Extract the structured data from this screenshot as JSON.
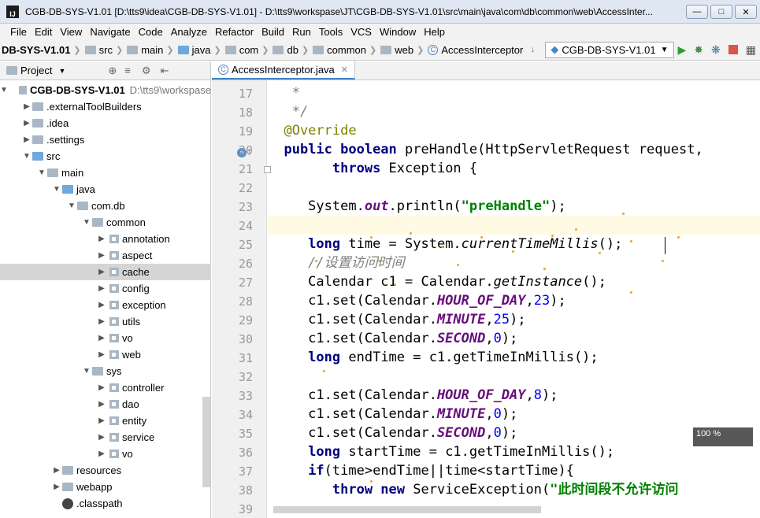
{
  "window": {
    "title": "CGB-DB-SYS-V1.01 [D:\\tts9\\idea\\CGB-DB-SYS-V1.01] - D:\\tts9\\workspase\\JT\\CGB-DB-SYS-V1.01\\src\\main\\java\\com\\db\\common\\web\\AccessInter..."
  },
  "menu": [
    "File",
    "Edit",
    "View",
    "Navigate",
    "Code",
    "Analyze",
    "Refactor",
    "Build",
    "Run",
    "Tools",
    "VCS",
    "Window",
    "Help"
  ],
  "breadcrumb": [
    "DB-SYS-V1.01",
    "src",
    "main",
    "java",
    "com",
    "db",
    "common",
    "web",
    "AccessInterceptor"
  ],
  "run_config": "CGB-DB-SYS-V1.01",
  "sidebar": {
    "title": "Project",
    "root_name": "CGB-DB-SYS-V1.01",
    "root_path": "D:\\tts9\\workspase",
    "items": [
      {
        "label": ".externalToolBuilders",
        "depth": 1,
        "arrow": "right"
      },
      {
        "label": ".idea",
        "depth": 1,
        "arrow": "right"
      },
      {
        "label": ".settings",
        "depth": 1,
        "arrow": "right"
      },
      {
        "label": "src",
        "depth": 1,
        "arrow": "down"
      },
      {
        "label": "main",
        "depth": 2,
        "arrow": "down"
      },
      {
        "label": "java",
        "depth": 3,
        "arrow": "down"
      },
      {
        "label": "com.db",
        "depth": 4,
        "arrow": "down"
      },
      {
        "label": "common",
        "depth": 5,
        "arrow": "down"
      },
      {
        "label": "annotation",
        "depth": 6,
        "arrow": "right"
      },
      {
        "label": "aspect",
        "depth": 6,
        "arrow": "right"
      },
      {
        "label": "cache",
        "depth": 6,
        "arrow": "right",
        "selected": true
      },
      {
        "label": "config",
        "depth": 6,
        "arrow": "right"
      },
      {
        "label": "exception",
        "depth": 6,
        "arrow": "right"
      },
      {
        "label": "utils",
        "depth": 6,
        "arrow": "right"
      },
      {
        "label": "vo",
        "depth": 6,
        "arrow": "right"
      },
      {
        "label": "web",
        "depth": 6,
        "arrow": "right"
      },
      {
        "label": "sys",
        "depth": 5,
        "arrow": "down"
      },
      {
        "label": "controller",
        "depth": 6,
        "arrow": "right"
      },
      {
        "label": "dao",
        "depth": 6,
        "arrow": "right"
      },
      {
        "label": "entity",
        "depth": 6,
        "arrow": "right"
      },
      {
        "label": "service",
        "depth": 6,
        "arrow": "right"
      },
      {
        "label": "vo",
        "depth": 6,
        "arrow": "right"
      },
      {
        "label": "resources",
        "depth": 3,
        "arrow": "right"
      },
      {
        "label": "webapp",
        "depth": 3,
        "arrow": "right"
      },
      {
        "label": ".classpath",
        "depth": 3,
        "arrow": ""
      }
    ]
  },
  "editor": {
    "tab_label": "AccessInterceptor.java",
    "line_numbers": [
      "17",
      "18",
      "19",
      "20",
      "21",
      "22",
      "23",
      "24",
      "25",
      "26",
      "27",
      "28",
      "29",
      "30",
      "31",
      "32",
      "33",
      "34",
      "35",
      "36",
      "37",
      "38",
      "39"
    ],
    "lines": [
      [
        {
          "t": "   *",
          "c": "cmt"
        }
      ],
      [
        {
          "t": "   */",
          "c": "cmt"
        }
      ],
      [
        {
          "t": "  @Override",
          "c": "ann"
        }
      ],
      [
        {
          "t": "  ",
          "c": ""
        },
        {
          "t": "public boolean ",
          "c": "kw"
        },
        {
          "t": "preHandle(HttpServletRequest request,",
          "c": ""
        }
      ],
      [
        {
          "t": "        ",
          "c": ""
        },
        {
          "t": "throws ",
          "c": "kw"
        },
        {
          "t": "Exception {",
          "c": ""
        }
      ],
      [],
      [
        {
          "t": "     System.",
          "c": ""
        },
        {
          "t": "out",
          "c": "fld"
        },
        {
          "t": ".println(",
          "c": ""
        },
        {
          "t": "\"preHandle\"",
          "c": "str"
        },
        {
          "t": ");",
          "c": ""
        }
      ],
      [],
      [
        {
          "t": "     ",
          "c": ""
        },
        {
          "t": "long ",
          "c": "kw"
        },
        {
          "t": "time = System.",
          "c": ""
        },
        {
          "t": "currentTimeMillis",
          "c": "stat"
        },
        {
          "t": "();",
          "c": ""
        }
      ],
      [
        {
          "t": "     //设置访问时间",
          "c": "cmt"
        }
      ],
      [
        {
          "t": "     Calendar c1 = Calendar.",
          "c": ""
        },
        {
          "t": "getInstance",
          "c": "stat"
        },
        {
          "t": "();",
          "c": ""
        }
      ],
      [
        {
          "t": "     c1.set(Calendar.",
          "c": ""
        },
        {
          "t": "HOUR_OF_DAY",
          "c": "fld"
        },
        {
          "t": ",",
          "c": ""
        },
        {
          "t": "23",
          "c": "num"
        },
        {
          "t": ");",
          "c": ""
        }
      ],
      [
        {
          "t": "     c1.set(Calendar.",
          "c": ""
        },
        {
          "t": "MINUTE",
          "c": "fld"
        },
        {
          "t": ",",
          "c": ""
        },
        {
          "t": "25",
          "c": "num"
        },
        {
          "t": ");",
          "c": ""
        }
      ],
      [
        {
          "t": "     c1.set(Calendar.",
          "c": ""
        },
        {
          "t": "SECOND",
          "c": "fld"
        },
        {
          "t": ",",
          "c": ""
        },
        {
          "t": "0",
          "c": "num"
        },
        {
          "t": ");",
          "c": ""
        }
      ],
      [
        {
          "t": "     ",
          "c": ""
        },
        {
          "t": "long ",
          "c": "kw"
        },
        {
          "t": "endTime = c1.getTimeInMillis();",
          "c": ""
        }
      ],
      [],
      [
        {
          "t": "     c1.set(Calendar.",
          "c": ""
        },
        {
          "t": "HOUR_OF_DAY",
          "c": "fld"
        },
        {
          "t": ",",
          "c": ""
        },
        {
          "t": "8",
          "c": "num"
        },
        {
          "t": ");",
          "c": ""
        }
      ],
      [
        {
          "t": "     c1.set(Calendar.",
          "c": ""
        },
        {
          "t": "MINUTE",
          "c": "fld"
        },
        {
          "t": ",",
          "c": ""
        },
        {
          "t": "0",
          "c": "num"
        },
        {
          "t": ");",
          "c": ""
        }
      ],
      [
        {
          "t": "     c1.set(Calendar.",
          "c": ""
        },
        {
          "t": "SECOND",
          "c": "fld"
        },
        {
          "t": ",",
          "c": ""
        },
        {
          "t": "0",
          "c": "num"
        },
        {
          "t": ");",
          "c": ""
        }
      ],
      [
        {
          "t": "     ",
          "c": ""
        },
        {
          "t": "long ",
          "c": "kw"
        },
        {
          "t": "startTime = c1.getTimeInMillis();",
          "c": ""
        }
      ],
      [
        {
          "t": "     ",
          "c": ""
        },
        {
          "t": "if",
          "c": "kw"
        },
        {
          "t": "(time>endTime||time<startTime){",
          "c": ""
        }
      ],
      [
        {
          "t": "        ",
          "c": ""
        },
        {
          "t": "throw new ",
          "c": "kw"
        },
        {
          "t": "ServiceException(",
          "c": ""
        },
        {
          "t": "\"此时间段不允许访问",
          "c": "str"
        }
      ],
      []
    ]
  },
  "overlay_text": "100 %",
  "colors": {
    "accent": "#4083c9",
    "caret_line": "#fffae3"
  }
}
